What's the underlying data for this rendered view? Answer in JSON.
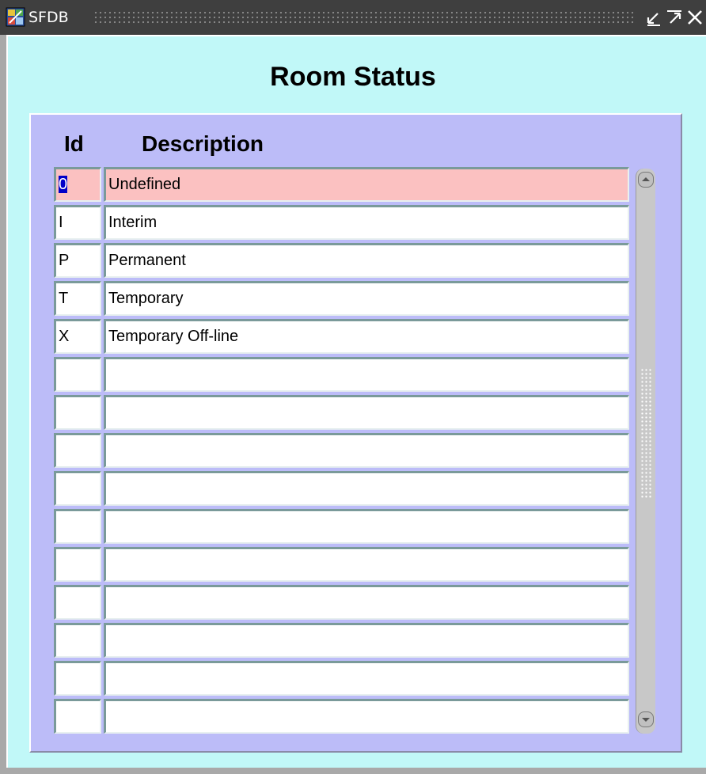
{
  "window": {
    "title": "SFDB",
    "controls": [
      "minimize-icon",
      "maximize-icon",
      "close-icon"
    ]
  },
  "form": {
    "title": "Room Status",
    "columns": {
      "id": "Id",
      "description": "Description"
    },
    "rows": [
      {
        "id": "0",
        "description": "Undefined",
        "current": true
      },
      {
        "id": "I",
        "description": "Interim"
      },
      {
        "id": "P",
        "description": "Permanent"
      },
      {
        "id": "T",
        "description": "Temporary"
      },
      {
        "id": "X",
        "description": "Temporary Off-line"
      },
      {
        "id": "",
        "description": ""
      },
      {
        "id": "",
        "description": ""
      },
      {
        "id": "",
        "description": ""
      },
      {
        "id": "",
        "description": ""
      },
      {
        "id": "",
        "description": ""
      },
      {
        "id": "",
        "description": ""
      },
      {
        "id": "",
        "description": ""
      },
      {
        "id": "",
        "description": ""
      },
      {
        "id": "",
        "description": ""
      },
      {
        "id": "",
        "description": ""
      }
    ]
  },
  "colors": {
    "titlebar": "#3f3f3f",
    "client_background": "#c1f8f8",
    "panel_background": "#bcbcf8",
    "current_record": "#fbc1c1",
    "selection": "#0000c8"
  }
}
